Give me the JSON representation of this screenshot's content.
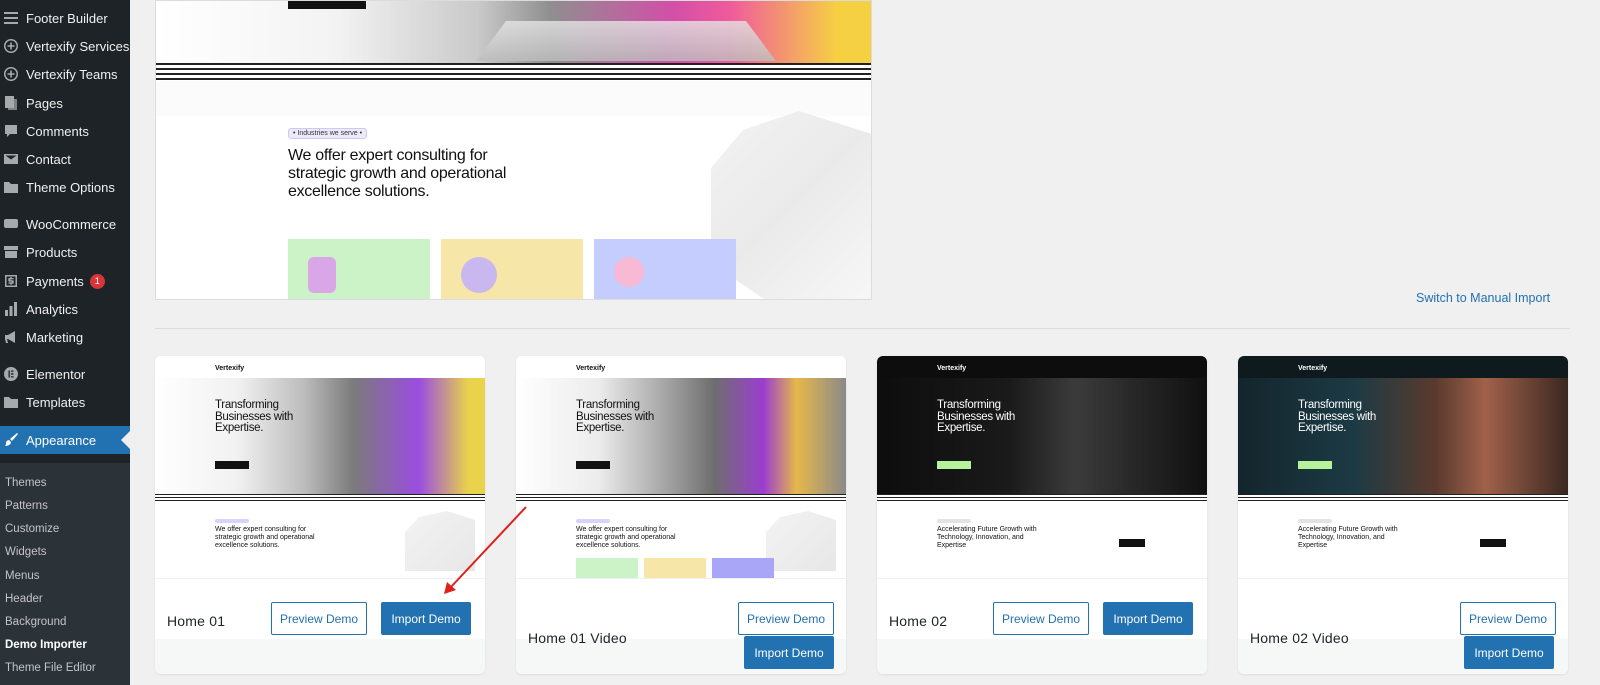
{
  "sidebar": {
    "items": [
      {
        "label": "Footer Builder",
        "icon": "list-icon"
      },
      {
        "label": "Vertexify Services",
        "icon": "plus-circle-icon"
      },
      {
        "label": "Vertexify Teams",
        "icon": "plus-circle-icon"
      },
      {
        "label": "Pages",
        "icon": "pages-icon"
      },
      {
        "label": "Comments",
        "icon": "comment-icon"
      },
      {
        "label": "Contact",
        "icon": "mail-icon"
      },
      {
        "label": "Theme Options",
        "icon": "folder-icon"
      },
      {
        "label": "WooCommerce",
        "icon": "woo-icon"
      },
      {
        "label": "Products",
        "icon": "archive-icon"
      },
      {
        "label": "Payments",
        "icon": "dollar-icon",
        "badge": "1"
      },
      {
        "label": "Analytics",
        "icon": "bar-chart-icon"
      },
      {
        "label": "Marketing",
        "icon": "megaphone-icon"
      },
      {
        "label": "Elementor",
        "icon": "elementor-icon"
      },
      {
        "label": "Templates",
        "icon": "folder-icon"
      },
      {
        "label": "Appearance",
        "icon": "brush-icon"
      }
    ],
    "submenu": [
      "Themes",
      "Patterns",
      "Customize",
      "Widgets",
      "Menus",
      "Header",
      "Background",
      "Demo Importer",
      "Theme File Editor"
    ]
  },
  "preview": {
    "tag": "• Industries we serve •",
    "heading": "We offer expert consulting for strategic growth and operational excellence solutions."
  },
  "switch_link": "Switch to Manual Import",
  "demos": [
    {
      "name": "Home 01",
      "preview_label": "Preview Demo",
      "import_label": "Import Demo",
      "theme": "light",
      "logo": "Vertexify",
      "hero": "Transforming Businesses with Expertise.",
      "lower": "We offer expert consulting for strategic growth and operational excellence solutions."
    },
    {
      "name": "Home 01 Video",
      "preview_label": "Preview Demo",
      "import_label": "Import Demo",
      "theme": "light",
      "logo": "Vertexify",
      "hero": "Transforming Businesses with Expertise.",
      "lower": "We offer expert consulting for strategic growth and operational excellence solutions."
    },
    {
      "name": "Home 02",
      "preview_label": "Preview Demo",
      "import_label": "Import Demo",
      "theme": "dark",
      "logo": "Vertexify",
      "hero": "Transforming Businesses with Expertise.",
      "lower": "Accelerating Future Growth with Technology, Innovation, and Expertise"
    },
    {
      "name": "Home 02 Video",
      "preview_label": "Preview Demo",
      "import_label": "Import Demo",
      "theme": "dark",
      "logo": "Vertexify",
      "hero": "Transforming Businesses with Expertise.",
      "lower": "Accelerating Future Growth with Technology, Innovation, and Expertise"
    }
  ],
  "colors": {
    "sidebar_bg": "#1d2327",
    "accent": "#2271b1",
    "badge": "#d63638",
    "annotation": "#e0201c"
  }
}
